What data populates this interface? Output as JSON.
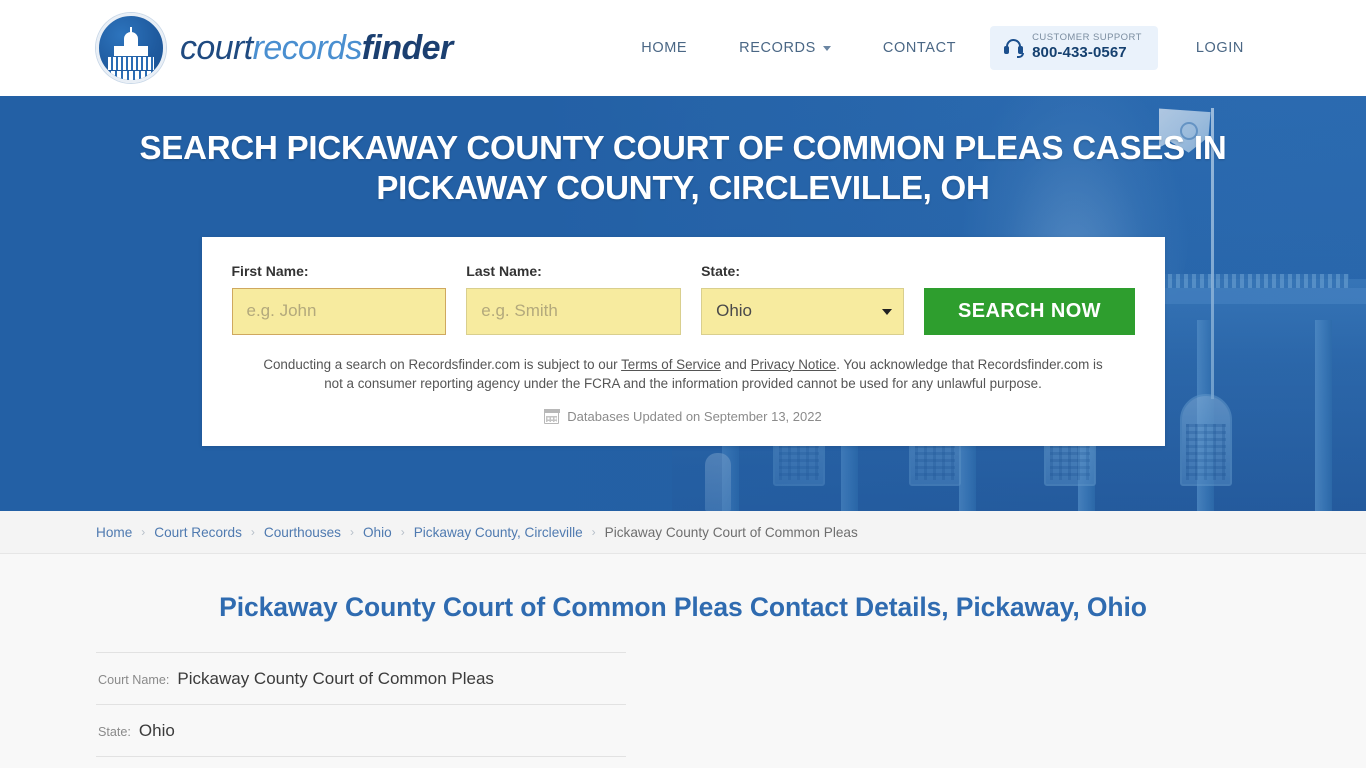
{
  "header": {
    "logo": {
      "emblem_icon": "capitol-dome-icon",
      "word1": "court",
      "word2": "records",
      "word3": "finder"
    },
    "nav": [
      {
        "label": "HOME",
        "name": "nav-home"
      },
      {
        "label": "RECORDS",
        "name": "nav-records",
        "has_chevron": true
      },
      {
        "label": "CONTACT",
        "name": "nav-contact"
      }
    ],
    "support": {
      "icon": "headset-icon",
      "label": "CUSTOMER SUPPORT",
      "number": "800-433-0567"
    },
    "login_label": "LOGIN"
  },
  "hero": {
    "title": "SEARCH PICKAWAY COUNTY COURT OF COMMON PLEAS CASES IN PICKAWAY COUNTY, CIRCLEVILLE, OH",
    "background_color": "#2360a5",
    "background_image": "courthouse-building-photo"
  },
  "search_form": {
    "first_name": {
      "label": "First Name:",
      "placeholder": "e.g. John",
      "value": ""
    },
    "last_name": {
      "label": "Last Name:",
      "placeholder": "e.g. Smith",
      "value": ""
    },
    "state": {
      "label": "State:",
      "value": "Ohio"
    },
    "submit_label": "SEARCH NOW",
    "submit_color": "#2e9e2e",
    "disclaimer_part1": "Conducting a search on Recordsfinder.com is subject to our ",
    "terms_link": "Terms of Service",
    "disclaimer_and": " and ",
    "privacy_link": "Privacy Notice",
    "disclaimer_part2": ". You acknowledge that Recordsfinder.com is not a consumer reporting agency under the FCRA and the information provided cannot be used for any unlawful purpose.",
    "updated_icon": "calendar-icon",
    "updated_text": "Databases Updated on September 13, 2022"
  },
  "breadcrumb": {
    "separator": "›",
    "items": [
      {
        "label": "Home"
      },
      {
        "label": "Court Records"
      },
      {
        "label": "Courthouses"
      },
      {
        "label": "Ohio"
      },
      {
        "label": "Pickaway County, Circleville"
      },
      {
        "label": "Pickaway County Court of Common Pleas"
      }
    ]
  },
  "main": {
    "page_title": "Pickaway County Court of Common Pleas Contact Details, Pickaway, Ohio",
    "page_title_color": "#2f6bb0",
    "details": [
      {
        "label": "Court Name:",
        "value": "Pickaway County Court of Common Pleas"
      },
      {
        "label": "State:",
        "value": "Ohio"
      }
    ]
  }
}
